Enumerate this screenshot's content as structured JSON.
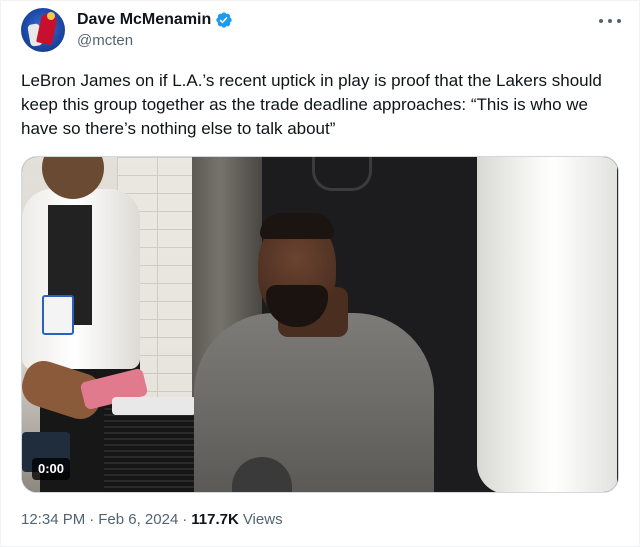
{
  "author": {
    "display_name": "Dave McMenamin",
    "handle": "@mcten",
    "verified": true,
    "avatar_icon": "nba-logo-avatar"
  },
  "tweet": {
    "text": "LeBron James on if L.A.’s recent uptick in play is proof that the Lakers should keep this group together as the trade deadline approaches: “This is who we have so there’s nothing else to talk about”"
  },
  "media": {
    "type": "video",
    "duration": "0:00"
  },
  "meta": {
    "time": "12:34 PM",
    "separator1": "·",
    "date": "Feb 6, 2024",
    "separator2": "·",
    "views_count": "117.7K",
    "views_label": "Views"
  },
  "colors": {
    "text_primary": "#0f1419",
    "text_secondary": "#536471",
    "verified_blue": "#1d9bf0",
    "border": "#cfd9de"
  },
  "icons": {
    "verified": "verified-badge-icon",
    "more": "more-options-icon"
  }
}
